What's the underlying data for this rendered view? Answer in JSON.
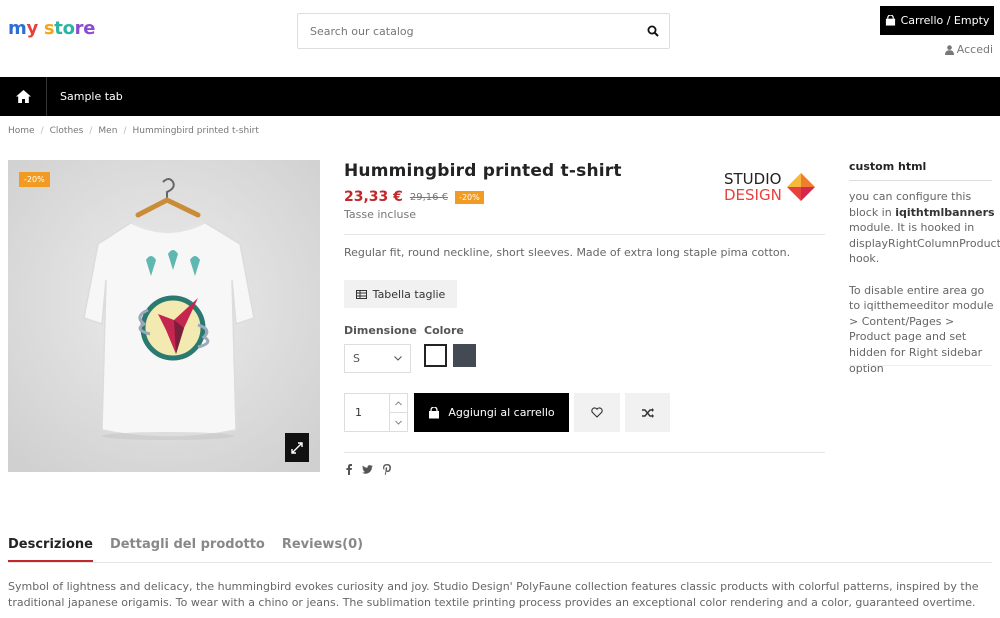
{
  "header": {
    "logo": {
      "p1": "m",
      "p2": "y",
      "p3": " s",
      "p4": "to",
      "p5": "re"
    },
    "search_placeholder": "Search our catalog",
    "cart_label": "Carrello / Empty",
    "login_label": "Accedi"
  },
  "nav": {
    "tab": "Sample tab"
  },
  "breadcrumb": [
    "Home",
    "Clothes",
    "Men",
    "Hummingbird printed t-shirt"
  ],
  "product": {
    "badge": "-20%",
    "title": "Hummingbird printed t-shirt",
    "price": "23,33 €",
    "old_price": "29,16 €",
    "discount": "-20%",
    "tax": "Tasse incluse",
    "brand_line1": "STUDIO",
    "brand_line2": "DESIGN",
    "short_desc": "Regular fit, round neckline, short sleeves. Made of extra long staple pima cotton.",
    "size_chart": "Tabella taglie",
    "size_label": "Dimensione",
    "color_label": "Colore",
    "size_value": "S",
    "qty": "1",
    "add_to_cart": "Aggiungi al carrello",
    "colors": {
      "white": "#ffffff",
      "grey": "#434a54"
    }
  },
  "sidebar": {
    "title": "custom html",
    "p1a": "you can configure this block in ",
    "p1b": "iqithtmlbanners",
    "p1c": " module. It is hooked in displayRightColumnProduct hook.",
    "p2": "To disable entire area go to iqitthemeeditor module > Content/Pages > Product page and set hidden for Right sidebar option"
  },
  "tabs": [
    "Descrizione",
    "Dettagli del prodotto",
    "Reviews(0)"
  ],
  "description": "Symbol of lightness and delicacy, the hummingbird evokes curiosity and joy. Studio Design' PolyFaune collection features classic products with colorful patterns, inspired by the traditional japanese origamis. To wear with a chino or jeans. The sublimation textile printing process provides an exceptional color rendering and a color, guaranteed overtime."
}
